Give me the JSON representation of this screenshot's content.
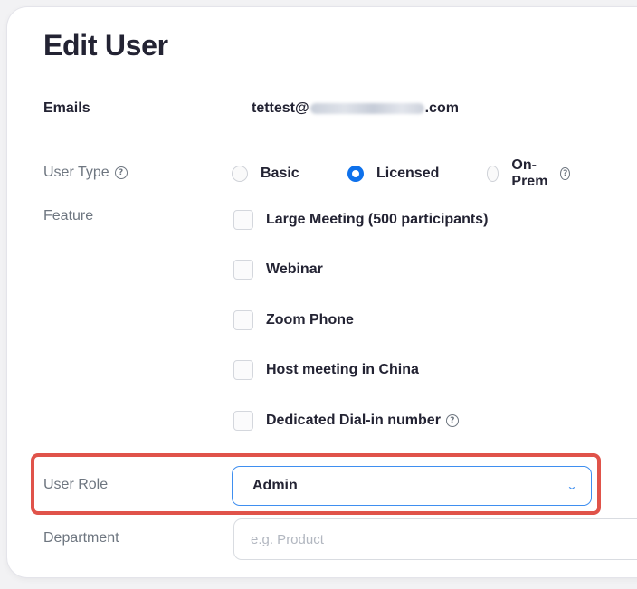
{
  "dialog": {
    "title": "Edit User"
  },
  "emails": {
    "label": "Emails",
    "prefix": "tettest@",
    "suffix": ".com"
  },
  "user_type": {
    "label": "User Type",
    "options": [
      {
        "label": "Basic",
        "checked": false
      },
      {
        "label": "Licensed",
        "checked": true
      },
      {
        "label": "On-Prem",
        "checked": false
      }
    ]
  },
  "feature": {
    "label": "Feature",
    "items": [
      {
        "label": "Large Meeting (500 participants)",
        "checked": false
      },
      {
        "label": "Webinar",
        "checked": false
      },
      {
        "label": "Zoom Phone",
        "checked": false
      },
      {
        "label": "Host meeting in China",
        "checked": false
      },
      {
        "label": "Dedicated Dial-in number",
        "checked": false
      }
    ]
  },
  "user_role": {
    "label": "User Role",
    "selected": "Admin"
  },
  "department": {
    "label": "Department",
    "value": "",
    "placeholder": "e.g. Product"
  },
  "colors": {
    "accent": "#0e71eb",
    "highlight": "#e0534a",
    "text": "#232333",
    "muted": "#6e7680"
  }
}
